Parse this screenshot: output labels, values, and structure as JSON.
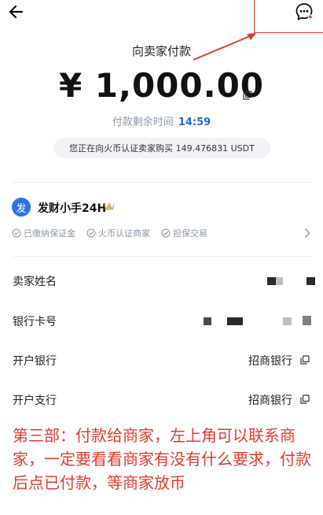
{
  "header": {
    "back_icon": "arrow-left-icon",
    "chat_icon": "chat-bubble-icon",
    "notification_dot_color": "#e0476a"
  },
  "payment": {
    "title": "向卖家付款",
    "amount": "¥ 1,000.00",
    "countdown_label": "付款剩余时间",
    "countdown_value": "14:59",
    "purchase_note": "您正在向火币认证卖家购买 149.476831 USDT"
  },
  "seller": {
    "avatar_char": "发",
    "name": "发财小手24H",
    "badges": [
      "已缴纳保证金",
      "火币认证商家",
      "担保交易"
    ]
  },
  "details": [
    {
      "label": "卖家姓名",
      "value": ""
    },
    {
      "label": "银行卡号",
      "value": ""
    },
    {
      "label": "开户银行",
      "value": "招商银行"
    },
    {
      "label": "开户支行",
      "value": "招商银行"
    }
  ],
  "annotation": {
    "text": "第三部：付款给商家，左上角可以联系商家，一定要看看商家有没有什么要求，付款后点已付款，等商家放币",
    "color": "#e23b2e"
  },
  "colors": {
    "accent_blue": "#2a66d8",
    "muted": "#8a95a8"
  }
}
